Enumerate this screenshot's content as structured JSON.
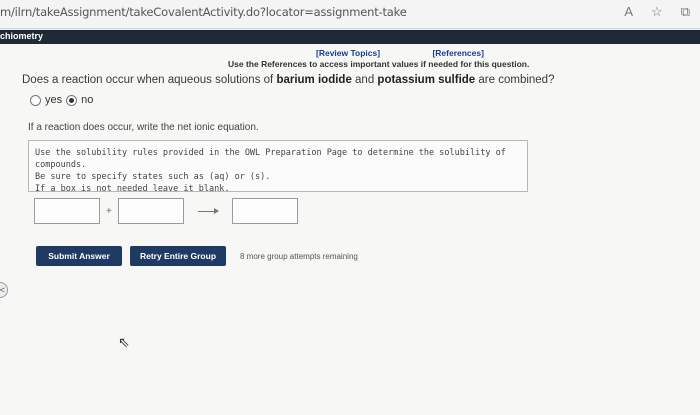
{
  "browser": {
    "url": "m/ilrn/takeAssignment/takeCovalentActivity.do?locator=assignment-take",
    "icons": [
      "reader-icon",
      "star-icon",
      "tabs-icon"
    ]
  },
  "app": {
    "title": "chiometry"
  },
  "refs": {
    "review_topics": "[Review Topics]",
    "references": "[References]",
    "note": "Use the References to access important values if needed for this question."
  },
  "question": {
    "before": "Does a reaction occur when aqueous solutions of ",
    "reactant1": "barium iodide",
    "middle": " and ",
    "reactant2": "potassium sulfide",
    "after": " are combined?",
    "options": [
      {
        "label": "yes",
        "selected": false
      },
      {
        "label": "no",
        "selected": true
      }
    ]
  },
  "prompt": "If a reaction does occur, write the net ionic equation.",
  "hints": [
    "Use the solubility rules provided in the OWL Preparation Page to determine the solubility of compounds.",
    "Be sure to specify states such as (aq) or (s).",
    "If a box is not needed leave it blank."
  ],
  "equation": {
    "plus": "+"
  },
  "buttons": {
    "submit": "Submit Answer",
    "retry": "Retry Entire Group"
  },
  "attempts": "8 more group attempts remaining"
}
